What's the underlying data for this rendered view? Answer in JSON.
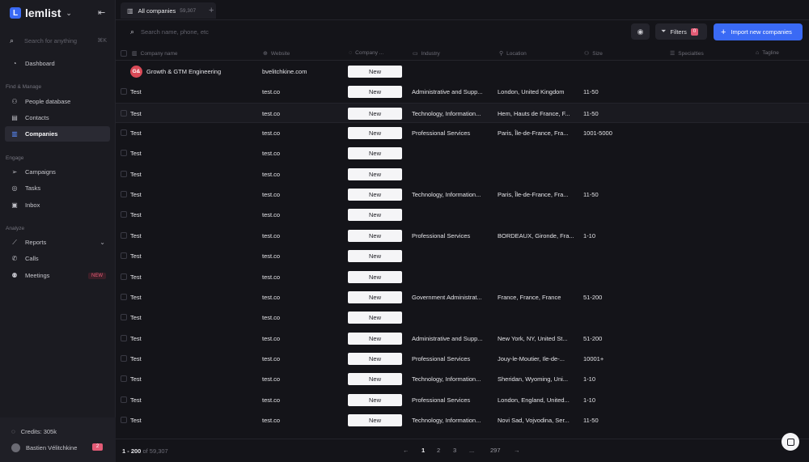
{
  "brand": {
    "name": "lemlist",
    "logo_letter": "L"
  },
  "search": {
    "placeholder": "Search for anything",
    "shortcut": "⌘K"
  },
  "sidebar": {
    "dashboard": "Dashboard",
    "section_find": "Find & Manage",
    "people": "People database",
    "contacts": "Contacts",
    "companies": "Companies",
    "section_engage": "Engage",
    "campaigns": "Campaigns",
    "tasks": "Tasks",
    "inbox": "Inbox",
    "section_analyze": "Analyze",
    "reports": "Reports",
    "calls": "Calls",
    "meetings": "Meetings",
    "meetings_badge": "NEW"
  },
  "bottom": {
    "credits": "Credits: 305k",
    "user": "Bastien Vélitchkine",
    "notifications": "2"
  },
  "tab": {
    "label": "All companies",
    "count": "59,307"
  },
  "toolbar": {
    "search_placeholder": "Search name, phone, etc",
    "filters_label": "Filters",
    "filters_count": "0",
    "import_label": "Import new companies"
  },
  "columns": {
    "name": "Company name",
    "website": "Website",
    "company_status": "Company ...",
    "industry": "Industry",
    "location": "Location",
    "size": "Size",
    "specialties": "Specialties",
    "tagline": "Tagline"
  },
  "rows": [
    {
      "name": "Growth & GTM Engineering",
      "avatar": "G&",
      "website": "bvelitchkine.com",
      "status": "New",
      "industry": "",
      "location": "",
      "size": ""
    },
    {
      "name": "Test",
      "website": "test.co",
      "status": "New",
      "industry": "Administrative and Supp...",
      "location": "London, United Kingdom",
      "size": "11-50"
    },
    {
      "name": "Test",
      "website": "test.co",
      "status": "New",
      "industry": "Technology, Information...",
      "location": "Hem, Hauts de France, F...",
      "size": "11-50"
    },
    {
      "name": "Test",
      "website": "test.co",
      "status": "New",
      "industry": "Professional Services",
      "location": "Paris, Île-de-France, Fra...",
      "size": "1001-5000"
    },
    {
      "name": "Test",
      "website": "test.co",
      "status": "New",
      "industry": "",
      "location": "",
      "size": ""
    },
    {
      "name": "Test",
      "website": "test.co",
      "status": "New",
      "industry": "",
      "location": "",
      "size": ""
    },
    {
      "name": "Test",
      "website": "test.co",
      "status": "New",
      "industry": "Technology, Information...",
      "location": "Paris, Île-de-France, Fra...",
      "size": "11-50"
    },
    {
      "name": "Test",
      "website": "test.co",
      "status": "New",
      "industry": "",
      "location": "",
      "size": ""
    },
    {
      "name": "Test",
      "website": "test.co",
      "status": "New",
      "industry": "Professional Services",
      "location": "BORDEAUX, Gironde, Fra...",
      "size": "1-10"
    },
    {
      "name": "Test",
      "website": "test.co",
      "status": "New",
      "industry": "",
      "location": "",
      "size": ""
    },
    {
      "name": "Test",
      "website": "test.co",
      "status": "New",
      "industry": "",
      "location": "",
      "size": ""
    },
    {
      "name": "Test",
      "website": "test.co",
      "status": "New",
      "industry": "Government Administrat...",
      "location": "France, France, France",
      "size": "51-200"
    },
    {
      "name": "Test",
      "website": "test.co",
      "status": "New",
      "industry": "",
      "location": "",
      "size": ""
    },
    {
      "name": "Test",
      "website": "test.co",
      "status": "New",
      "industry": "Administrative and Supp...",
      "location": "New York, NY, United St...",
      "size": "51-200"
    },
    {
      "name": "Test",
      "website": "test.co",
      "status": "New",
      "industry": "Professional Services",
      "location": "Jouy-le-Moutier, Ile-de-...",
      "size": "10001+"
    },
    {
      "name": "Test",
      "website": "test.co",
      "status": "New",
      "industry": "Technology, Information...",
      "location": "Sheridan, Wyoming, Uni...",
      "size": "1-10"
    },
    {
      "name": "Test",
      "website": "test.co",
      "status": "New",
      "industry": "Professional Services",
      "location": "London, England, United...",
      "size": "1-10"
    },
    {
      "name": "Test",
      "website": "test.co",
      "status": "New",
      "industry": "Technology, Information...",
      "location": "Novi Sad, Vojvodina, Ser...",
      "size": "11-50"
    }
  ],
  "pagination": {
    "range": "1 - 200",
    "of": "of 59,307",
    "pages": [
      "1",
      "2",
      "3",
      "...",
      "297"
    ],
    "current": "1"
  }
}
